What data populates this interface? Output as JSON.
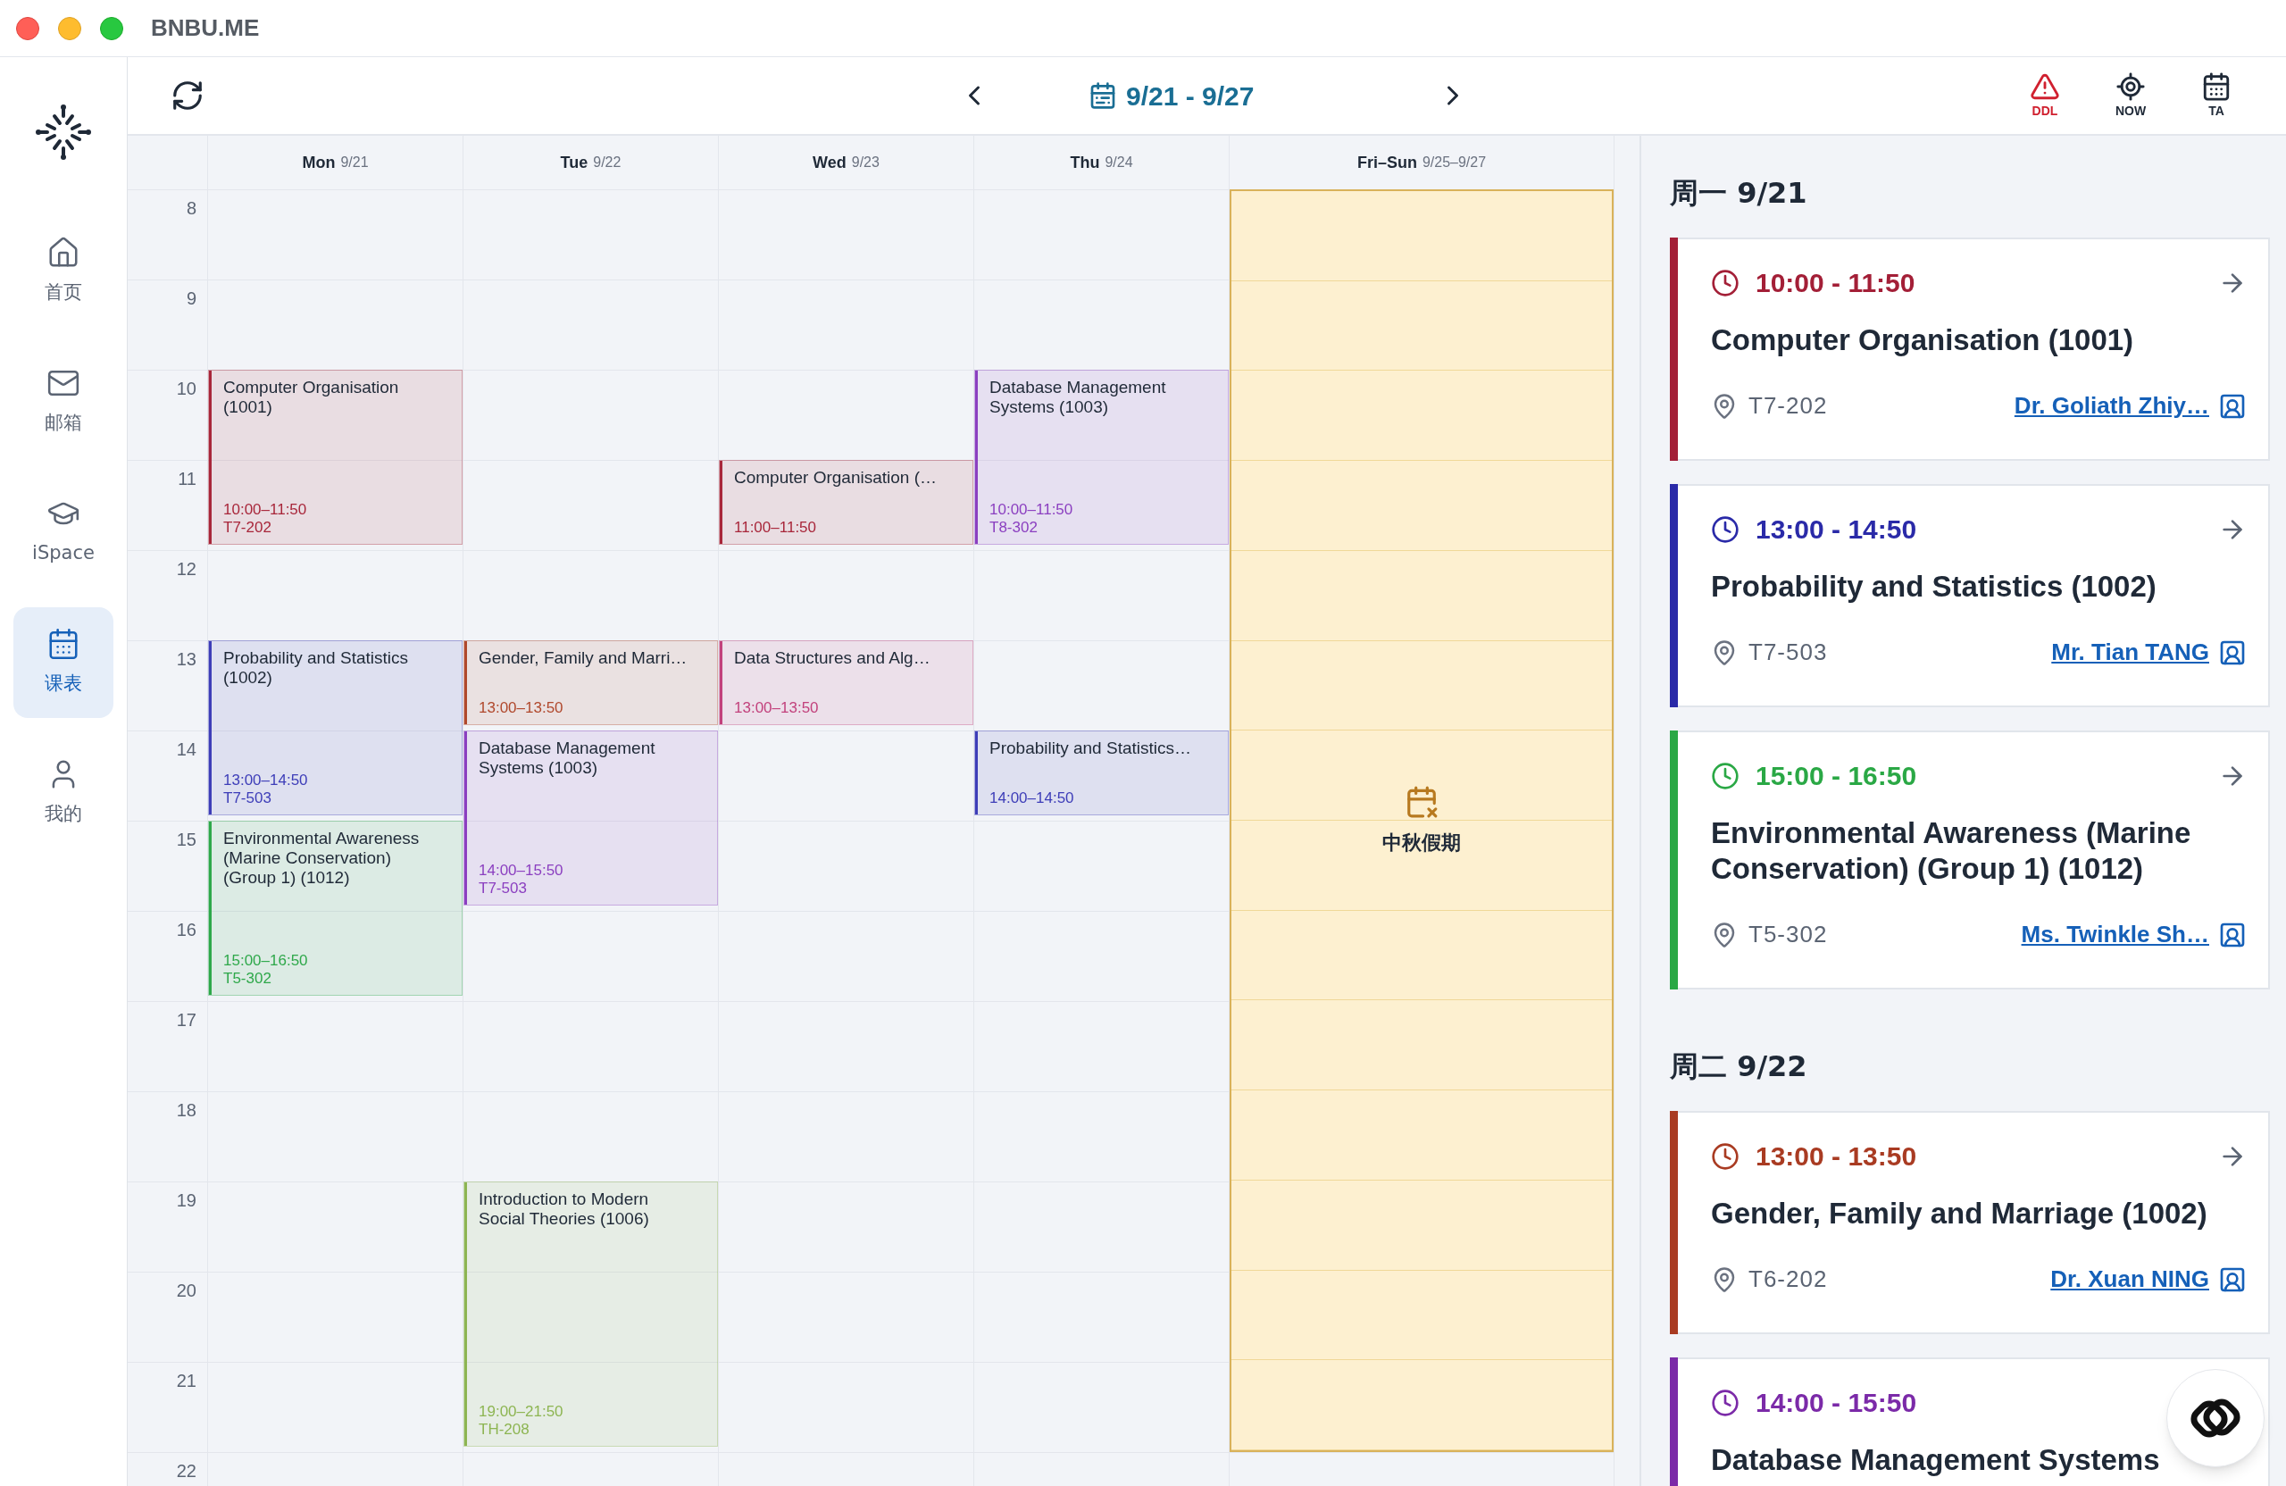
{
  "window": {
    "title": "BNBU.ME"
  },
  "sidebar": {
    "items": [
      {
        "label": "首页",
        "kind": "home",
        "selected": false
      },
      {
        "label": "邮箱",
        "kind": "mail",
        "selected": false
      },
      {
        "label": "iSpace",
        "kind": "cap",
        "selected": false
      },
      {
        "label": "课表",
        "kind": "calendar",
        "selected": true
      },
      {
        "label": "我的",
        "kind": "user",
        "selected": false
      }
    ]
  },
  "toolbar": {
    "date_range": "9/21 - 9/27",
    "actions": [
      {
        "label": "DDL",
        "kind": "warning"
      },
      {
        "label": "NOW",
        "kind": "locate"
      },
      {
        "label": "TA",
        "kind": "calendar"
      }
    ]
  },
  "calendar": {
    "hours": [
      "8",
      "9",
      "10",
      "11",
      "12",
      "13",
      "14",
      "15",
      "16",
      "17",
      "18",
      "19",
      "20",
      "21",
      "22"
    ],
    "days": [
      {
        "name": "Mon",
        "date": "9/21",
        "events": [
          {
            "title": "Computer Organisation (1001)",
            "time": "10:00–11:50",
            "room": "T7-202",
            "color": "#a8263a"
          },
          {
            "title": "Probability and Statistics (1002)",
            "time": "13:00–14:50",
            "room": "T7-503",
            "color": "#3d3db8"
          },
          {
            "title": "Environmental Awareness (Marine Conservation) (Group 1) (1012)",
            "time": "15:00–16:50",
            "room": "T5-302",
            "color": "#2ea84a"
          }
        ]
      },
      {
        "name": "Tue",
        "date": "9/22",
        "events": [
          {
            "title": "Gender, Family and Marri…",
            "time": "13:00–13:50",
            "color": "#b0482c"
          },
          {
            "title": "Database Management Systems (1003)",
            "time": "14:00–15:50",
            "room": "T7-503",
            "color": "#8b3fc0"
          },
          {
            "title": "Introduction to Modern Social Theories (1006)",
            "time": "19:00–21:50",
            "room": "TH-208",
            "color": "#8db552"
          }
        ]
      },
      {
        "name": "Wed",
        "date": "9/23",
        "events": [
          {
            "title": "Computer Organisation (…",
            "time": "11:00–11:50",
            "color": "#a8263a"
          },
          {
            "title": "Data Structures and Alg…",
            "time": "13:00–13:50",
            "color": "#c2417c"
          }
        ]
      },
      {
        "name": "Thu",
        "date": "9/24",
        "events": [
          {
            "title": "Database Management Systems (1003)",
            "time": "10:00–11:50",
            "room": "T8-302",
            "color": "#8b3fc0"
          },
          {
            "title": "Probability and Statistics…",
            "time": "14:00–14:50",
            "color": "#3d3db8"
          }
        ]
      },
      {
        "name": "Fri–Sun",
        "date": "9/25–9/27",
        "holiday": "中秋假期"
      }
    ]
  },
  "agenda": [
    {
      "heading": "周一 9/21",
      "classes": [
        {
          "time": "10:00 - 11:50",
          "title": "Computer Organisation (1001)",
          "room": "T7-202",
          "teacher": "Dr. Goliath Zhiy…",
          "color": "#a31f37"
        },
        {
          "time": "13:00 - 14:50",
          "title": "Probability and Statistics (1002)",
          "room": "T7-503",
          "teacher": "Mr. Tian TANG",
          "color": "#2a2aa8"
        },
        {
          "time": "15:00 - 16:50",
          "title": "Environmental Awareness (Marine Conservation) (Group 1) (1012)",
          "room": "T5-302",
          "teacher": "Ms. Twinkle Sh…",
          "color": "#2aa845"
        }
      ]
    },
    {
      "heading": "周二 9/22",
      "classes": [
        {
          "time": "13:00 - 13:50",
          "title": "Gender, Family and Marriage (1002)",
          "room": "T6-202",
          "teacher": "Dr. Xuan NING",
          "color": "#a93b22"
        },
        {
          "time": "14:00 - 15:50",
          "title": "Database Management Systems",
          "color": "#7b2aa8"
        }
      ]
    }
  ]
}
